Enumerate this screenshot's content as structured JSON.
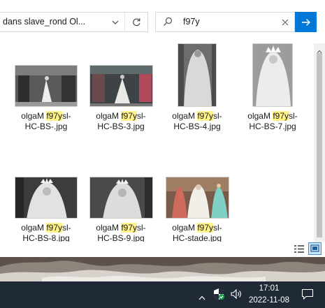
{
  "address_bar": {
    "path": "dans slave_rond Ol..."
  },
  "search": {
    "query": "f97y"
  },
  "files": [
    {
      "prefix": "olgaM ",
      "match": "f97y",
      "rest": "sl-",
      "line2": "HC-BS-.jpg"
    },
    {
      "prefix": "olgaM ",
      "match": "f97y",
      "rest": "sl-",
      "line2": "HC-BS-3.jpg"
    },
    {
      "prefix": "olgaM ",
      "match": "f97y",
      "rest": "sl-",
      "line2": "HC-BS-4.jpg"
    },
    {
      "prefix": "olgaM ",
      "match": "f97y",
      "rest": "sl-",
      "line2": "HC-BS-7.jpg"
    },
    {
      "prefix": "olgaM ",
      "match": "f97y",
      "rest": "sl-",
      "line2": "HC-BS-8.jpg"
    },
    {
      "prefix": "olgaM ",
      "match": "f97y",
      "rest": "sl-",
      "line2": "HC-BS-9.jpg"
    },
    {
      "prefix": "olgaM ",
      "match": "f97y",
      "rest": "sl-",
      "line2": "HC-stade.jpg"
    }
  ],
  "taskbar": {
    "time": "17:01",
    "date": "2022-11-08"
  },
  "colors": {
    "accent": "#0078d7",
    "highlight": "#fff38a",
    "taskbar": "#1f2a36"
  },
  "icons": [
    "chevron-down-icon",
    "refresh-icon",
    "search-icon",
    "close-icon",
    "arrow-right-icon",
    "details-view-icon",
    "large-icons-view-icon",
    "chevron-up-icon",
    "security-shield-icon",
    "volume-icon",
    "notification-icon"
  ]
}
